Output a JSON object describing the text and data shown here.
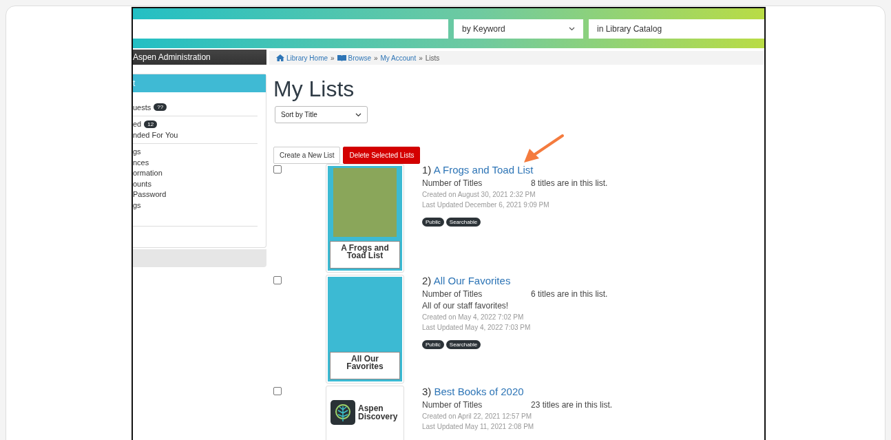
{
  "header": {
    "search_type": "by Keyword",
    "search_scope": "in Library Catalog"
  },
  "admin_menu": {
    "label": "Aspen Administration"
  },
  "sidebar": {
    "title": "t",
    "groups": [
      {
        "items": [
          {
            "label": "uests",
            "badge": "??"
          }
        ]
      },
      {
        "items": [
          {
            "label": "ed",
            "badge": "12"
          },
          {
            "label": "nded For You"
          }
        ]
      },
      {
        "items": [
          {
            "label": "gs"
          },
          {
            "label": "nces"
          },
          {
            "label": "ormation"
          },
          {
            "label": "ounts"
          },
          {
            "label": " Password"
          },
          {
            "label": "gs"
          }
        ]
      }
    ]
  },
  "breadcrumbs": [
    {
      "label": "Library Home",
      "kind": "home",
      "link": true
    },
    {
      "separator": "»",
      "label": "Browse",
      "kind": "book",
      "link": true
    },
    {
      "separator": "»",
      "label": "My Account",
      "link": true
    },
    {
      "separator": "»",
      "label": "Lists",
      "link": false
    }
  ],
  "title": "My Lists",
  "sort": {
    "value": "Sort by Title"
  },
  "buttons": [
    {
      "label": "Create a New List",
      "kind": "default"
    },
    {
      "label": "Delete Selected Lists",
      "kind": "danger"
    }
  ],
  "lists": [
    {
      "checked": false,
      "number": "1)",
      "title": "A Frogs and Toad List",
      "count_label": "Number of Titles",
      "count": "8 titles are in this list.",
      "created": "Created on August 30, 2021 2:32 PM",
      "updated": "Last Updated December 6, 2021 9:09 PM",
      "tags": [
        "Public",
        "Searchable"
      ],
      "cover": {
        "kind": "photo",
        "label": "A Frogs and Toad List"
      }
    },
    {
      "checked": false,
      "number": "2)",
      "title": "All Our Favorites",
      "count_label": "Number of Titles",
      "count": "6 titles are in this list.",
      "description": "All of our staff favorites!",
      "created": "Created on May 4, 2022 7:02 PM",
      "updated": "Last Updated May 4, 2022 7:03 PM",
      "tags": [
        "Public",
        "Searchable"
      ],
      "cover": {
        "kind": "plain",
        "label": "All Our Favorites"
      }
    },
    {
      "checked": false,
      "number": "3)",
      "title": "Best Books of 2020",
      "count_label": "Number of Titles",
      "count": "23 titles are in this list.",
      "created": "Created on April 22, 2021 12:57 PM",
      "updated": "Last Updated May 11, 2021 2:08 PM",
      "cover": {
        "kind": "logo",
        "label": "Aspen Discovery"
      }
    }
  ]
}
